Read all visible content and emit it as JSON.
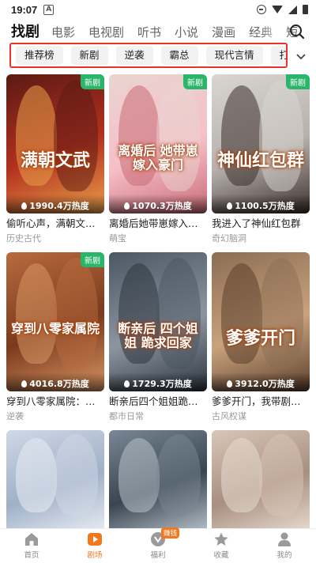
{
  "status_bar": {
    "time": "19:07",
    "notif_letter": "A"
  },
  "top_tabs": {
    "items": [
      {
        "label": "找剧",
        "active": true
      },
      {
        "label": "电影"
      },
      {
        "label": "电视剧"
      },
      {
        "label": "听书"
      },
      {
        "label": "小说"
      },
      {
        "label": "漫画"
      },
      {
        "label": "经典"
      },
      {
        "label": "短"
      }
    ]
  },
  "tags": [
    "推荐榜",
    "新剧",
    "逆袭",
    "霸总",
    "现代言情",
    "打脸"
  ],
  "cards": [
    {
      "title": "偷听心声，满朝文武...",
      "genre": "历史古代",
      "heat": "1990.4万热度",
      "badge": "新剧",
      "art": "满朝文武",
      "colors": [
        "#5a1a14",
        "#b3301f",
        "#e9a04a"
      ]
    },
    {
      "title": "离婚后她带崽嫁入豪...",
      "genre": "萌宝",
      "heat": "1070.3万热度",
      "badge": "新剧",
      "art": "离婚后 她带崽 嫁入豪门",
      "colors": [
        "#e9d4d0",
        "#f6c0c8",
        "#c96a76"
      ]
    },
    {
      "title": "我进入了神仙红包群",
      "genre": "奇幻脑洞",
      "heat": "1100.5万热度",
      "badge": "新剧",
      "art": "神仙红包群",
      "colors": [
        "#d9d6d2",
        "#b7b1ad",
        "#3c2f2a"
      ]
    },
    {
      "title": "穿到八零家属院：撩...",
      "genre": "逆袭",
      "heat": "4016.8万热度",
      "badge": "新剧",
      "art": "穿到八零家属院",
      "colors": [
        "#b86b3d",
        "#7a3a1e",
        "#d99663"
      ]
    },
    {
      "title": "断亲后四个姐姐跪求...",
      "genre": "都市日常",
      "heat": "1729.3万热度",
      "badge": "",
      "art": "断亲后 四个姐姐 跪求回家",
      "colors": [
        "#4a5662",
        "#8c95a0",
        "#2d3640"
      ]
    },
    {
      "title": "爹爹开门，我带剧本...",
      "genre": "古风权谋",
      "heat": "3912.0万热度",
      "badge": "",
      "art": "爹爹开门",
      "colors": [
        "#8b6d53",
        "#c9a27d",
        "#5b3f2c"
      ]
    },
    {
      "title": "",
      "genre": "",
      "heat": "",
      "badge": "",
      "art": "",
      "colors": [
        "#cfd8e6",
        "#9fb0c8",
        "#e9edf4"
      ]
    },
    {
      "title": "",
      "genre": "",
      "heat": "",
      "badge": "",
      "art": "",
      "colors": [
        "#7a8794",
        "#394652",
        "#b9c2cb"
      ]
    },
    {
      "title": "",
      "genre": "",
      "heat": "",
      "badge": "",
      "art": "",
      "colors": [
        "#d9c6b8",
        "#a88f80",
        "#e8dcd2"
      ]
    }
  ],
  "bottom_nav": [
    {
      "label": "首页",
      "icon": "home-icon"
    },
    {
      "label": "剧场",
      "icon": "theater-icon",
      "active": true
    },
    {
      "label": "福利",
      "icon": "gift-icon",
      "badge": "赚钱"
    },
    {
      "label": "收藏",
      "icon": "star-icon"
    },
    {
      "label": "我的",
      "icon": "user-icon"
    }
  ],
  "colors": {
    "accent": "#f0781e",
    "highlight_border": "#e8332b",
    "new_badge": "#29b66a"
  }
}
